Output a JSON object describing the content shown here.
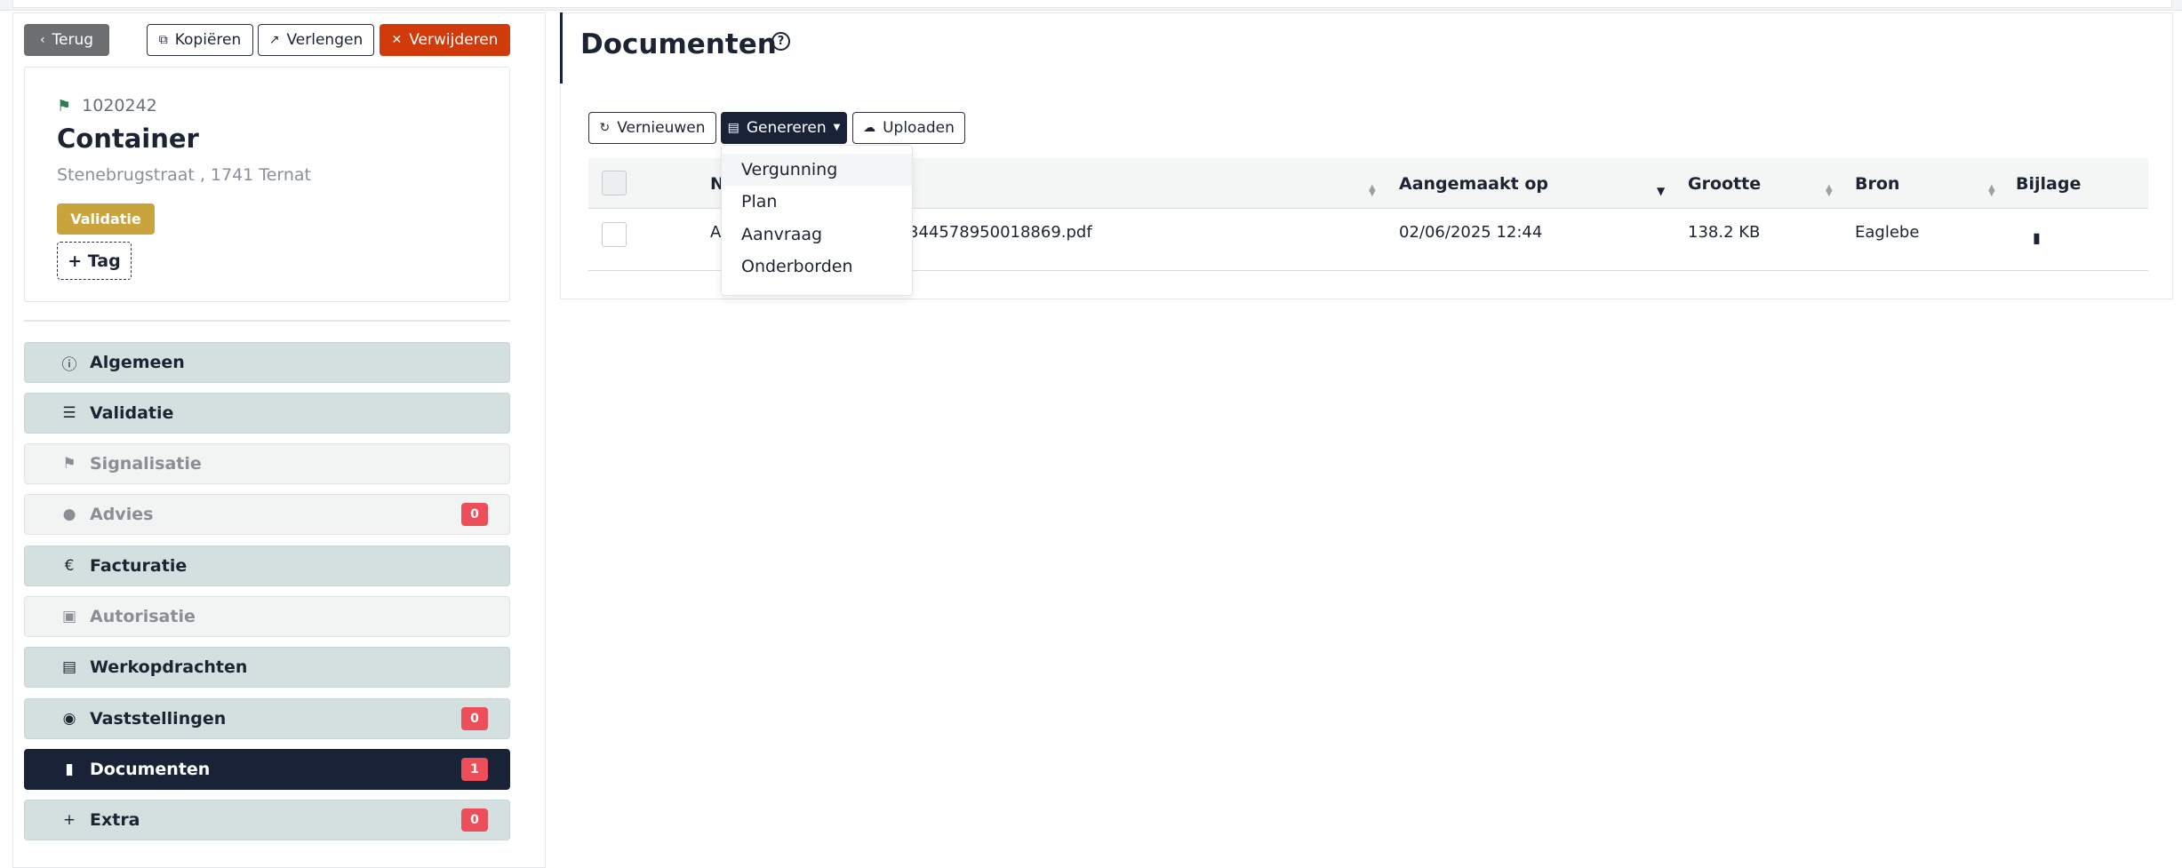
{
  "toolbar": {
    "back_label": "Terug",
    "copy_label": "Kopiëren",
    "extend_label": "Verlengen",
    "delete_label": "Verwijderen"
  },
  "card": {
    "id": "1020242",
    "title": "Container",
    "address": "Stenebrugstraat , 1741 Ternat",
    "status_badge": "Validatie",
    "tag_button": "+ Tag"
  },
  "sidebar": {
    "items": [
      {
        "label": "Algemeen",
        "icon": "info-icon",
        "state": "ok"
      },
      {
        "label": "Validatie",
        "icon": "checklist-icon",
        "state": "ok"
      },
      {
        "label": "Signalisatie",
        "icon": "signpost-icon",
        "state": "disabled"
      },
      {
        "label": "Advies",
        "icon": "comment-icon",
        "state": "disabled",
        "count": "0"
      },
      {
        "label": "Facturatie",
        "icon": "euro-icon",
        "state": "ok"
      },
      {
        "label": "Autorisatie",
        "icon": "file-lock-icon",
        "state": "disabled"
      },
      {
        "label": "Werkopdrachten",
        "icon": "file-icon",
        "state": "ok"
      },
      {
        "label": "Vaststellingen",
        "icon": "eye-icon",
        "state": "ok",
        "count": "0"
      },
      {
        "label": "Documenten",
        "icon": "document-icon",
        "state": "current",
        "count": "1"
      },
      {
        "label": "Extra",
        "icon": "plus-icon",
        "state": "ok",
        "count": "0"
      }
    ]
  },
  "main": {
    "title": "Documenten",
    "buttons": {
      "renew": "Vernieuwen",
      "generate": "Genereren",
      "upload": "Uploaden"
    },
    "dropdown": [
      "Vergunning",
      "Plan",
      "Aanvraag",
      "Onderborden"
    ],
    "table": {
      "columns": [
        "N",
        "Aangemaakt op",
        "Grootte",
        "Bron",
        "Bijlage"
      ],
      "rows": [
        {
          "name_start": "A",
          "name_end": "344578950018869.pdf",
          "created": "02/06/2025 12:44",
          "size": "138.2 KB",
          "source": "Eaglebe"
        }
      ]
    }
  },
  "colors": {
    "primary_dark": "#1a2238",
    "danger": "#d13b0c",
    "validation_badge": "#c9a43d",
    "count_badge": "#ec4f5a",
    "nav_active": "#d4dfdf"
  }
}
